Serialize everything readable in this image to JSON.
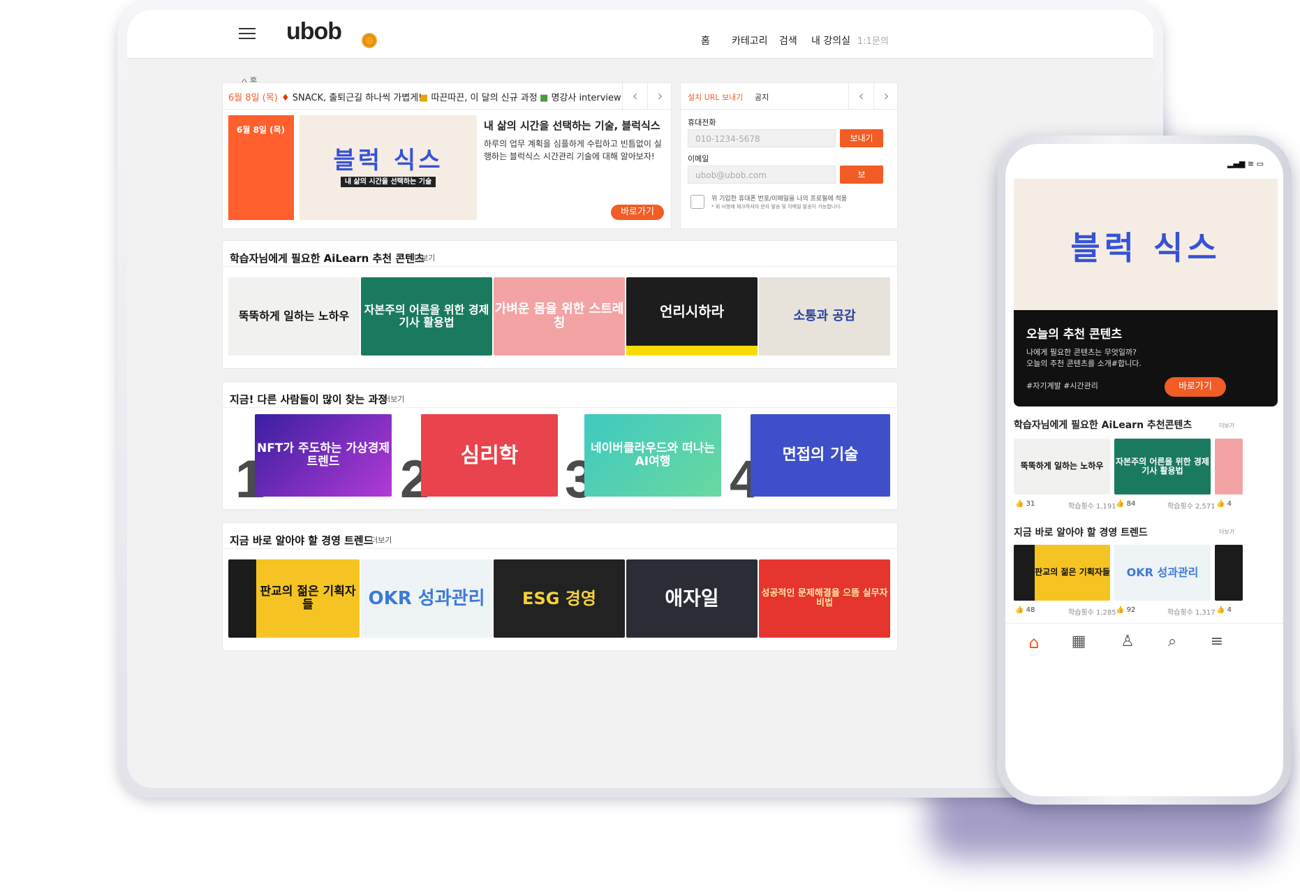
{
  "header": {
    "logo": "ubob",
    "nav": [
      "홈",
      "카테고리",
      "검색",
      "내 강의실",
      "1:1문의"
    ]
  },
  "breadcrumb": "홈",
  "today_tabs": [
    "6월 8일 (목)",
    "SNACK, 출퇴근길 하나씩 가볍게!",
    "따끈따끈, 이 달의 신규 과정",
    "명강사 interview"
  ],
  "feature": {
    "date": "6월 8일 (목)",
    "thumb_title": "블럭 식스",
    "thumb_sub": "내 삶의 시간을 선택하는 기술",
    "title": "내 삶의 시간을 선택하는 기술, 블럭식스",
    "desc": "하루의 업무 계획을 심플하게 수립하고 빈틈없이 실행하는 블럭식스 시간관리 기술에 대해 알아보자!",
    "button": "바로가기"
  },
  "install": {
    "tabs": [
      "설치 URL 보내기",
      "공지"
    ],
    "phone_label": "휴대전화",
    "phone_placeholder": "010-1234-5678",
    "send": "보내기",
    "email_label": "이메일",
    "email_placeholder": "ubob@ubob.com",
    "send2": "보",
    "consent": "위 기입한 휴대폰 번호/이메일을 나의 프로필에 적용",
    "note": "* 위 사항에 체크하셔야 문자 발송 및 이메일 발송이 가능합니다."
  },
  "section1": {
    "title": "학습자님에게 필요한 AiLearn 추천 콘텐츠",
    "more": "더보기",
    "items": [
      "뚝뚝하게 일하는 노하우",
      "자본주의 어른을 위한 경제기사 활용법",
      "가벼운 몸을 위한 스트레칭",
      "언리시하라",
      "소통과 공감"
    ]
  },
  "section2": {
    "title": "지금! 다른 사람들이 많이 찾는 과정",
    "more": "더보기",
    "items": [
      {
        "rank": "1",
        "label": "NFT가 주도하는 가상경제 트렌드"
      },
      {
        "rank": "2",
        "label": "심리학"
      },
      {
        "rank": "3",
        "label": "네이버클라우드와 떠나는 AI여행"
      },
      {
        "rank": "4",
        "label": "면접의 기술"
      }
    ]
  },
  "section3": {
    "title": "지금 바로 알아야 할 경영 트렌드",
    "more": "더보기",
    "items": [
      "판교의 젊은 기획자들",
      "OKR 성과관리",
      "ESG 경영",
      "애자일",
      "성공적인 문제해결을 으뜸 실무자 비법"
    ]
  },
  "phone": {
    "hero_title": "오늘의 추천 콘텐츠",
    "hero_desc1": "나에게 필요한 콘텐츠는 무엇일까?",
    "hero_desc2": "오늘의 추천 콘텐츠를 소개#합니다.",
    "hero_tags": "#자기계발 #시간관리",
    "hero_button": "바로가기",
    "sec1_title": "학습자님에게 필요한 AiLearn 추천콘텐츠",
    "sec1_more": "더보기",
    "sec1_items": [
      {
        "label": "뚝뚝하게 일하는 노하우",
        "likes": "31",
        "views_label": "학습횟수",
        "views": "1,191"
      },
      {
        "label": "자본주의 어른을 위한 경제기사 활용법",
        "likes": "84",
        "views_label": "학습횟수",
        "views": "2,571"
      },
      {
        "label": "",
        "likes": "4",
        "views_label": "",
        "views": ""
      }
    ],
    "sec2_title": "지금 바로 알아야 할 경영 트렌드",
    "sec2_more": "더보기",
    "sec2_items": [
      {
        "label": "판교의 젊은 기획자들",
        "likes": "48",
        "views_label": "학습횟수",
        "views": "1,285"
      },
      {
        "label": "OKR 성과관리",
        "likes": "92",
        "views_label": "학습횟수",
        "views": "1,317"
      },
      {
        "label": "",
        "likes": "4",
        "views_label": "",
        "views": ""
      }
    ]
  },
  "colors": {
    "accent": "#f25c25",
    "dark": "#111111"
  }
}
